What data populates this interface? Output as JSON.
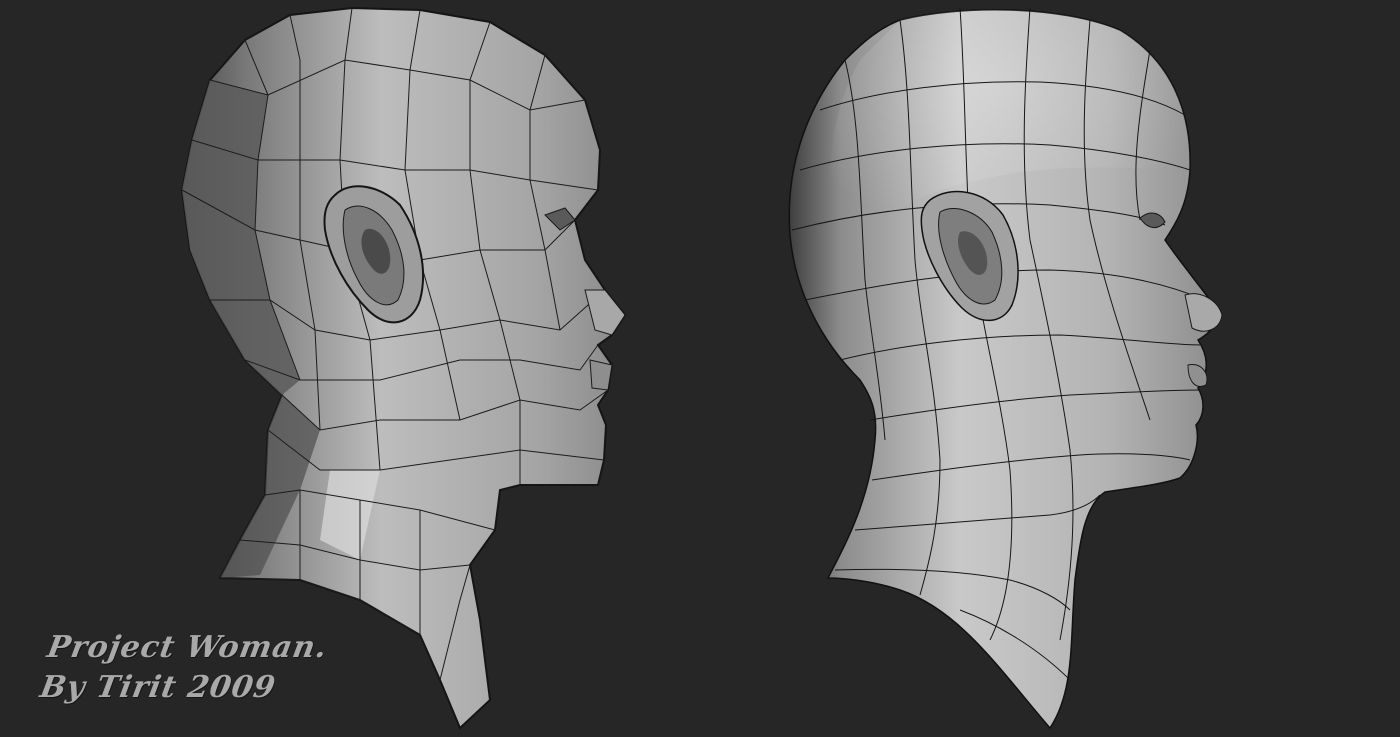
{
  "caption": {
    "line1": "Project Woman.",
    "line2": "By Tirit 2009"
  },
  "colors": {
    "background": "#262626",
    "model_light": "#c8c8c8",
    "model_mid": "#9a9a9a",
    "model_dark": "#555555",
    "wire": "#1e1e1e",
    "caption": "#a9a9a9"
  },
  "views": [
    {
      "name": "low-poly head mesh",
      "shading": "flat faceted"
    },
    {
      "name": "subdivided head mesh",
      "shading": "smooth"
    }
  ]
}
